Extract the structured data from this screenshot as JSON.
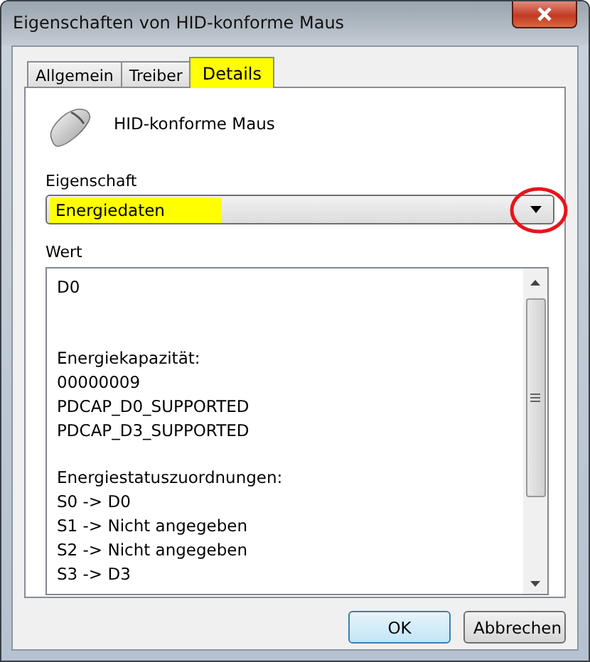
{
  "window": {
    "title": "Eigenschaften von HID-konforme Maus"
  },
  "tabs": [
    {
      "label": "Allgemein",
      "selected": false,
      "highlighted": false
    },
    {
      "label": "Treiber",
      "selected": false,
      "highlighted": false
    },
    {
      "label": "Details",
      "selected": true,
      "highlighted": true
    }
  ],
  "device": {
    "name": "HID-konforme Maus"
  },
  "property": {
    "label": "Eigenschaft",
    "value": "Energiedaten",
    "highlighted": true,
    "circled": true
  },
  "value_list": {
    "label": "Wert",
    "groups": [
      {
        "lines": [
          "D0"
        ]
      },
      {
        "lines": [
          "Energiekapazität:",
          "00000009",
          "PDCAP_D0_SUPPORTED",
          "PDCAP_D3_SUPPORTED"
        ]
      },
      {
        "lines": [
          "Energiestatuszuordnungen:",
          "S0 -> D0",
          "S1 -> Nicht angegeben",
          "S2 -> Nicht angegeben",
          "S3 -> D3"
        ]
      }
    ]
  },
  "buttons": [
    {
      "label": "OK",
      "default": true
    },
    {
      "label": "Abbrechen",
      "default": false
    }
  ]
}
